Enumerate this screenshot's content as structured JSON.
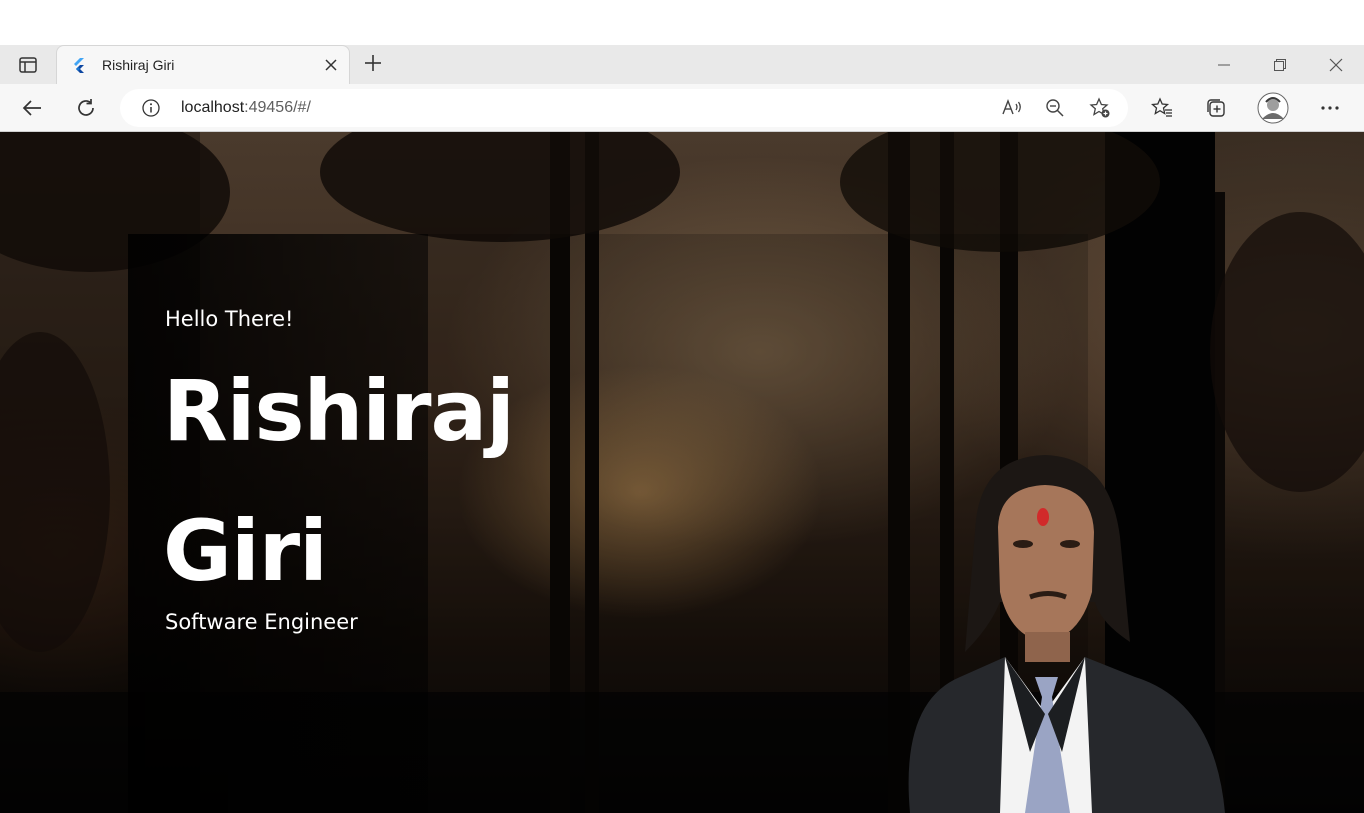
{
  "browser": {
    "tab": {
      "title": "Rishiraj Giri"
    },
    "address": {
      "host": "localhost",
      "rest": ":49456/#/"
    },
    "icons": {
      "tab_actions": "tab-actions-icon",
      "favicon": "flutter-icon",
      "close_tab": "close-icon",
      "new_tab": "plus-icon",
      "minimize": "minimize-icon",
      "restore": "restore-icon",
      "close_window": "close-icon",
      "back": "back-arrow-icon",
      "refresh": "refresh-icon",
      "site_info": "info-icon",
      "read_aloud": "read-aloud-icon",
      "zoom_out": "zoom-out-icon",
      "add_favorite": "star-add-icon",
      "favorites": "favorites-icon",
      "collections": "collections-icon",
      "profile": "avatar",
      "more": "more-icon"
    },
    "accent": "#0f6cbd"
  },
  "page": {
    "greeting": "Hello There!",
    "name_first": "Rishiraj",
    "name_last": "Giri",
    "role": "Software Engineer",
    "text_color": "#ffffff"
  }
}
